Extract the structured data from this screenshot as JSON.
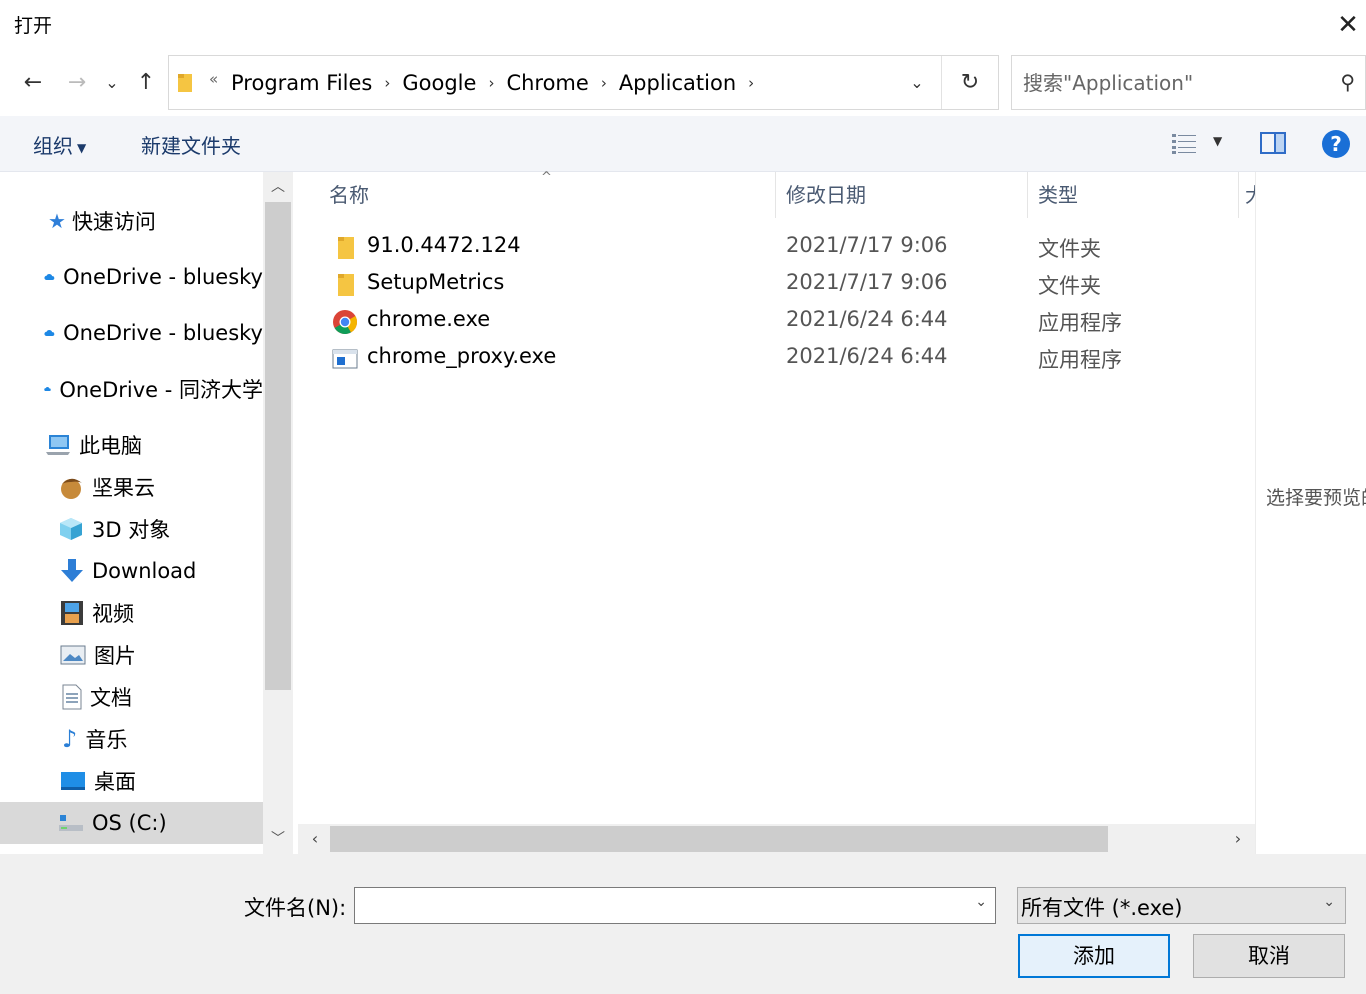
{
  "window": {
    "title": "打开"
  },
  "nav": {
    "back": "←",
    "forward": "→",
    "recent": "⌄",
    "up": "↑"
  },
  "address": {
    "overflow": "«",
    "crumbs": [
      "Program Files",
      "Google",
      "Chrome",
      "Application"
    ],
    "refresh": "↻"
  },
  "search": {
    "placeholder": "搜索\"Application\""
  },
  "commands": {
    "organize": "组织",
    "new_folder": "新建文件夹",
    "help": "?"
  },
  "sidebar": {
    "items": [
      {
        "label": "快速访问",
        "icon": "star-icon"
      },
      {
        "label": "OneDrive - bluesky",
        "icon": "cloud-icon"
      },
      {
        "label": "OneDrive - bluesky",
        "icon": "cloud-icon"
      },
      {
        "label": "OneDrive - 同济大学",
        "icon": "cloud-icon"
      },
      {
        "label": "此电脑",
        "icon": "computer-icon"
      },
      {
        "label": "坚果云",
        "icon": "nut-icon"
      },
      {
        "label": "3D 对象",
        "icon": "cube-icon"
      },
      {
        "label": "Download",
        "icon": "download-icon"
      },
      {
        "label": "视频",
        "icon": "video-icon"
      },
      {
        "label": "图片",
        "icon": "picture-icon"
      },
      {
        "label": "文档",
        "icon": "document-icon"
      },
      {
        "label": "音乐",
        "icon": "music-icon"
      },
      {
        "label": "桌面",
        "icon": "desktop-icon"
      },
      {
        "label": "OS (C:)",
        "icon": "drive-icon"
      }
    ]
  },
  "columns": {
    "name": "名称",
    "date": "修改日期",
    "type": "类型",
    "size": "大"
  },
  "files": [
    {
      "name": "91.0.4472.124",
      "date": "2021/7/17 9:06",
      "type": "文件夹",
      "icon": "folder-icon"
    },
    {
      "name": "SetupMetrics",
      "date": "2021/7/17 9:06",
      "type": "文件夹",
      "icon": "folder-icon"
    },
    {
      "name": "chrome.exe",
      "date": "2021/6/24 6:44",
      "type": "应用程序",
      "icon": "chrome-icon"
    },
    {
      "name": "chrome_proxy.exe",
      "date": "2021/6/24 6:44",
      "type": "应用程序",
      "icon": "exe-icon"
    }
  ],
  "preview": {
    "message": "选择要预览的文件。"
  },
  "bottom": {
    "filename_label": "文件名(N):",
    "filename_value": "",
    "filter_value": "所有文件 (*.exe)",
    "open_label": "添加",
    "cancel_label": "取消"
  },
  "colors": {
    "accent": "#0078d7",
    "selection": "#d9d9d9",
    "command_text": "#1b3a6b"
  }
}
